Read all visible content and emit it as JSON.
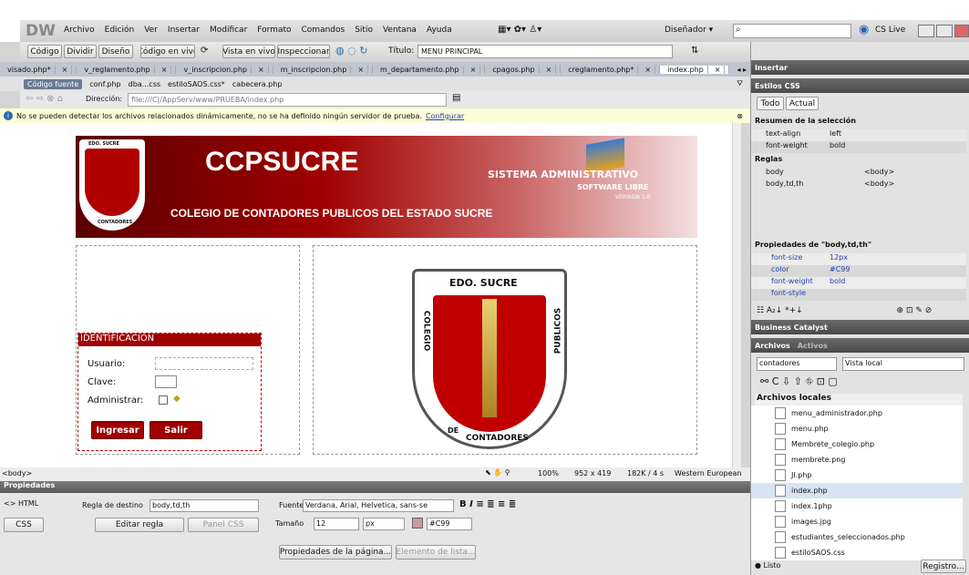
{
  "app": {
    "logo": "DW",
    "menu": [
      "Archivo",
      "Edición",
      "Ver",
      "Insertar",
      "Modificar",
      "Formato",
      "Comandos",
      "Sitio",
      "Ventana",
      "Ayuda"
    ],
    "workspace": "Diseñador ▾",
    "search_placeholder": "",
    "cslive": "CS Live"
  },
  "docbar": {
    "buttons": [
      "Código",
      "Dividir",
      "Diseño",
      "Código en vivo",
      "Vista en vivo",
      "Inspeccionar"
    ],
    "title_label": "Título:",
    "title_value": "MENU PRINCIPAL"
  },
  "tabs": [
    "visado.php*",
    "v_reglamento.php",
    "v_inscripcion.php",
    "m_inscripcion.php",
    "m_departamento.php",
    "cpagos.php",
    "creglamento.php*",
    "index.php"
  ],
  "related": {
    "source": "Código fuente",
    "files": [
      "conf.php",
      "dba...css",
      "estiloSAOS.css*",
      "cabecera.php"
    ]
  },
  "address": {
    "label": "Dirección:",
    "value": "file:///C|/AppServ/www/PRUEBA/index.php"
  },
  "info": {
    "text": "No se pueden detectar los archivos relacionados dinámicamente, no se ha definido ningún servidor de prueba.",
    "link": "Configurar"
  },
  "banner": {
    "title": "CCPSUCRE",
    "sub": "COLEGIO DE CONTADORES PUBLICOS DEL ESTADO SUCRE",
    "sys": "SISTEMA ADMINISTRATIVO",
    "soft": "SOFTWARE LIBRE",
    "ver": "VERSION 1.0",
    "seal_top": "EDO. SUCRE",
    "seal_left": "COLEGIO",
    "seal_right": "PUBLICOS",
    "seal_bottom": "CONTADORES",
    "seal_de": "DE"
  },
  "login": {
    "header": "IDENTIFICACIÓN",
    "user": "Usuario:",
    "pass": "Clave:",
    "admin": "Administrar:",
    "ingresar": "Ingresar",
    "salir": "Salir"
  },
  "big_seal": {
    "top": "EDO. SUCRE",
    "left": "COLEGIO",
    "right": "PUBLICOS",
    "bottom": "CONTADORES",
    "de": "DE"
  },
  "status": {
    "tag": "<body>",
    "zoom": "100%",
    "size": "952 x 419",
    "weight": "182K / 4 s",
    "encoding": "Western European"
  },
  "props": {
    "title": "Propiedades",
    "html": "HTML",
    "css": "CSS",
    "target_label": "Regla de destino",
    "target": "body,td,th",
    "edit": "Editar regla",
    "panel": "Panel CSS",
    "font_label": "Fuente",
    "font": "Verdana, Arial, Helvetica, sans-se",
    "size_label": "Tamaño",
    "size": "12",
    "unit": "px",
    "color": "#C99",
    "page_props": "Propiedades de la página...",
    "list": "Elemento de lista..."
  },
  "right": {
    "insertar": "Insertar",
    "css_title": "Estilos CSS",
    "todo": "Todo",
    "actual": "Actual",
    "resumen": "Resumen de la selección",
    "summary": [
      [
        "text-align",
        "left"
      ],
      [
        "font-weight",
        "bold"
      ]
    ],
    "reglas": "Reglas",
    "rules": [
      [
        "body",
        "<body>"
      ],
      [
        "body,td,th",
        "<body>"
      ]
    ],
    "props_title": "Propiedades de \"body,td,th\"",
    "properties": [
      [
        "font-size",
        "12px"
      ],
      [
        "color",
        "#C99"
      ],
      [
        "font-weight",
        "bold"
      ],
      [
        "font-style",
        ""
      ]
    ],
    "bc": "Business Catalyst",
    "archivos": "Archivos",
    "activos": "Activos",
    "site": "contadores",
    "view": "Vista local",
    "locales": "Archivos locales",
    "files": [
      "menu_administrador.php",
      "menu.php",
      "Membrete_colegio.php",
      "membrete.png",
      "JI.php",
      "index.php",
      "index.1php",
      "images.jpg",
      "estudiantes_seleccionados.php",
      "estiloSAOS.css"
    ],
    "listo": "Listo",
    "registro": "Registro..."
  }
}
